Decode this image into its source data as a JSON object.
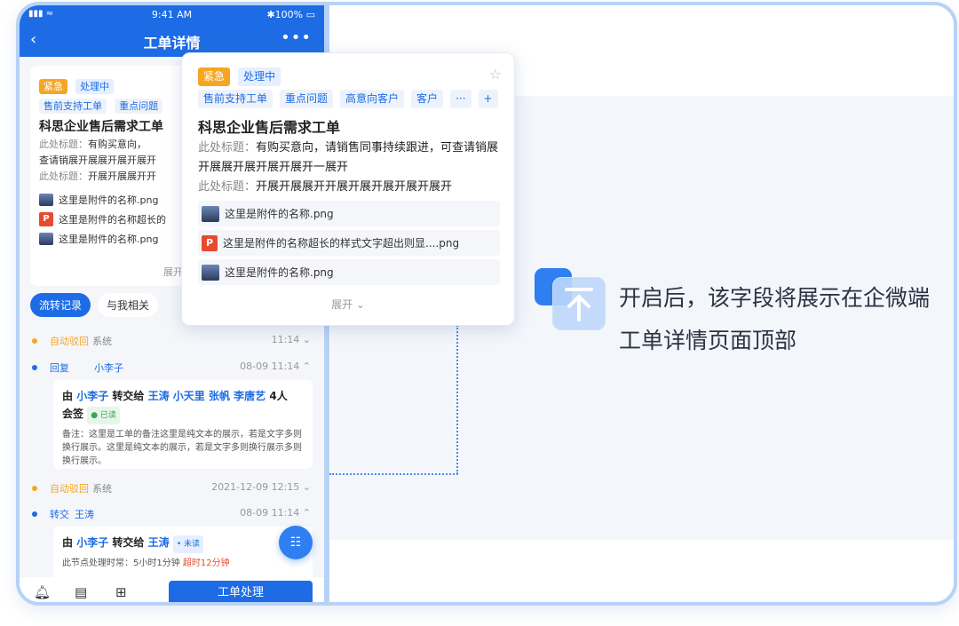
{
  "phone": {
    "status": {
      "signal": "▮▮▮ ≈",
      "time": "9:41 AM",
      "battery": "✱100% ▭"
    },
    "nav": {
      "back": "‹",
      "title": "工单详情",
      "more": "•••"
    },
    "card": {
      "tag_urgent": "紧急",
      "tag_status": "处理中",
      "tags": [
        "售前支持工单",
        "重点问题"
      ],
      "title": "科思企业售后需求工单",
      "desc_label1": "此处标题：",
      "desc_text1": "有购买意向，",
      "desc_line2": "查请销展开展展开展开展开",
      "desc_label3": "此处标题：",
      "desc_text3": "开展开展展开开",
      "attachments": [
        {
          "type": "image",
          "name": "这里是附件的名称.png"
        },
        {
          "type": "pdf",
          "icon": "P",
          "name": "这里是附件的名称超长的"
        },
        {
          "type": "image",
          "name": "这里是附件的名称.png"
        }
      ],
      "expand": "展开"
    },
    "tabs": [
      "流转记录",
      "与我相关"
    ],
    "logs": [
      {
        "type": "自动驳回",
        "who": "系统",
        "time": "11:14 ⌄"
      },
      {
        "type": "回复",
        "who": "小李子",
        "time": "08-09 11:14 ⌃"
      },
      {
        "type": "自动驳回",
        "who": "系统",
        "time": "2021-12-09 12:15 ⌄"
      },
      {
        "type": "转交",
        "who": "王涛",
        "time": "08-09 11:14 ⌃"
      }
    ],
    "detail1": {
      "prefix": "由",
      "from": "小李子",
      "verb": "转交给",
      "to": "王涛 小天里 张帆 李唐艺",
      "count": "4人",
      "line2": "会签",
      "read": "● 已读",
      "note": "备注：这里是工单的备注这里是纯文本的展示，若是文字多则换行展示。这里是纯文本的展示，若是文字多则换行展示多则换行展示。"
    },
    "detail2": {
      "prefix": "由",
      "from": "小李子",
      "verb": "转交给",
      "to": "王涛",
      "read": "• 未读",
      "time_label": "此节点处理时常：5小时1分钟",
      "overtime": "超时12分钟"
    },
    "fab_icon": "☷",
    "bottom": {
      "bell": "🔔︎",
      "msg": "▤",
      "add": "⊞",
      "main": "工单处理"
    }
  },
  "popup": {
    "tag_urgent": "紧急",
    "tag_status": "处理中",
    "star": "☆",
    "tags": [
      "售前支持工单",
      "重点问题",
      "高意向客户",
      "客户",
      "···",
      "+"
    ],
    "title": "科思企业售后需求工单",
    "desc_label1": "此处标题：",
    "desc_text1": "有购买意向，请销售同事持续跟进，可查请销展开展展开展开展开展开一展开",
    "desc_label2": "此处标题：",
    "desc_text2": "开展开展展开开展开展开展开展开展开",
    "attachments": [
      {
        "type": "image",
        "name": "这里是附件的名称.png"
      },
      {
        "type": "pdf",
        "icon": "P",
        "name": "这里是附件的名称超长的样式文字超出则显....png"
      },
      {
        "type": "image",
        "name": "这里是附件的名称.png"
      }
    ],
    "expand": "展开 ⌄"
  },
  "feature": {
    "line1": "开启后，该字段将展示在企微端",
    "line2": "工单详情页面顶部"
  }
}
